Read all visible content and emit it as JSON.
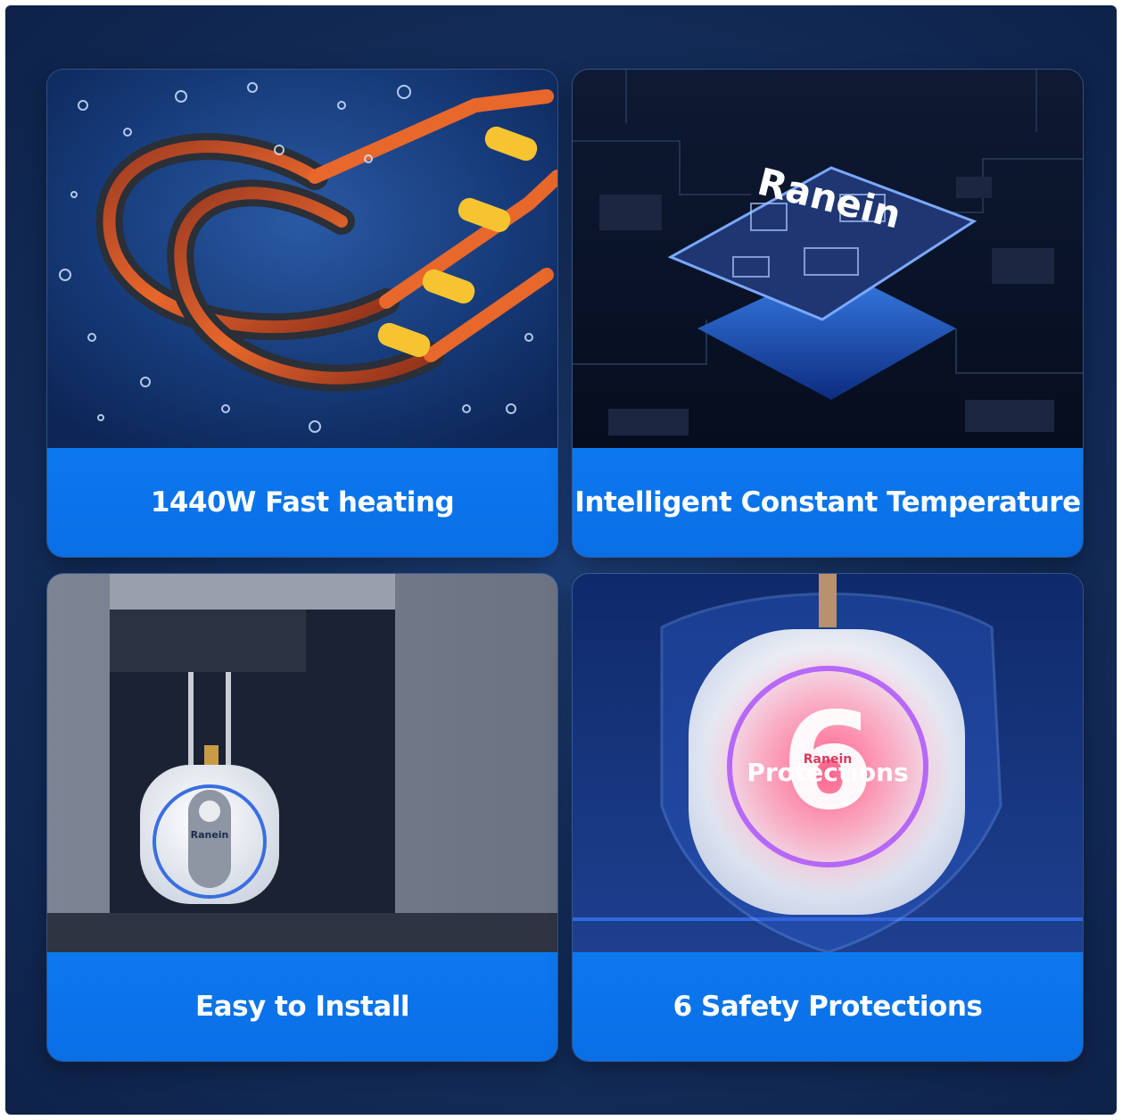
{
  "features": [
    {
      "id": "fast-heating",
      "label": "1440W Fast heating"
    },
    {
      "id": "constant-temperature",
      "label": "Intelligent Constant Temperature",
      "chip_logo": "Ranein"
    },
    {
      "id": "easy-install",
      "label": "Easy to Install",
      "heater_logo": "Ranein"
    },
    {
      "id": "safety-protections",
      "label": "6 Safety Protections",
      "badge_number": "6",
      "badge_text": "Protections",
      "heater_logo": "Ranein"
    }
  ],
  "colors": {
    "background": "#15305f",
    "band": "#0a6fe6",
    "text": "#ffffff"
  },
  "icons": [
    "heating-element-image",
    "chip-image",
    "water-heater-under-sink-image",
    "shield-protection-image"
  ]
}
